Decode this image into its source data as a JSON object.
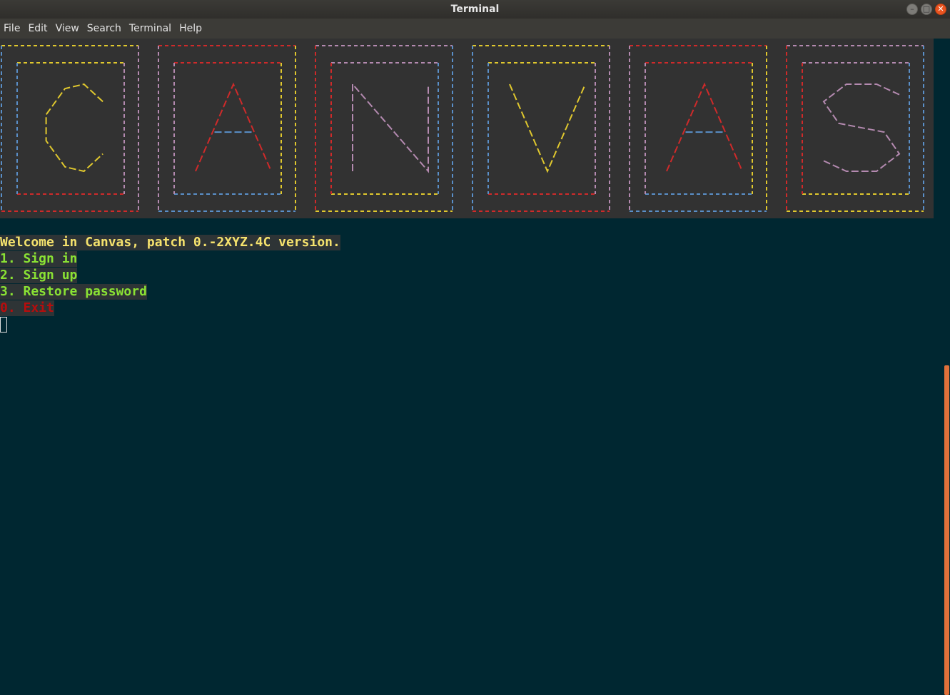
{
  "window": {
    "title": "Terminal"
  },
  "menu": [
    "File",
    "Edit",
    "View",
    "Search",
    "Terminal",
    "Help"
  ],
  "banner": {
    "text": "CANVAS",
    "letters": [
      "C",
      "A",
      "N",
      "V",
      "A",
      "S"
    ]
  },
  "terminal": {
    "welcome": "Welcome in Canvas, patch 0.-2XYZ.4C version.",
    "options": [
      {
        "label": "1. Sign in",
        "color": "green"
      },
      {
        "label": "2. Sign up",
        "color": "green"
      },
      {
        "label": "3. Restore password",
        "color": "green"
      },
      {
        "label": "0. Exit",
        "color": "red"
      }
    ]
  },
  "colors": {
    "background": "#002731",
    "yellow": "#f5e26d",
    "green": "#8ae234",
    "red": "#b70d0d",
    "ascii": [
      "#e0c82e",
      "#cf2a2a",
      "#5a8fc8",
      "#b48ab0"
    ],
    "scroll_thumb": "#e0703a"
  }
}
